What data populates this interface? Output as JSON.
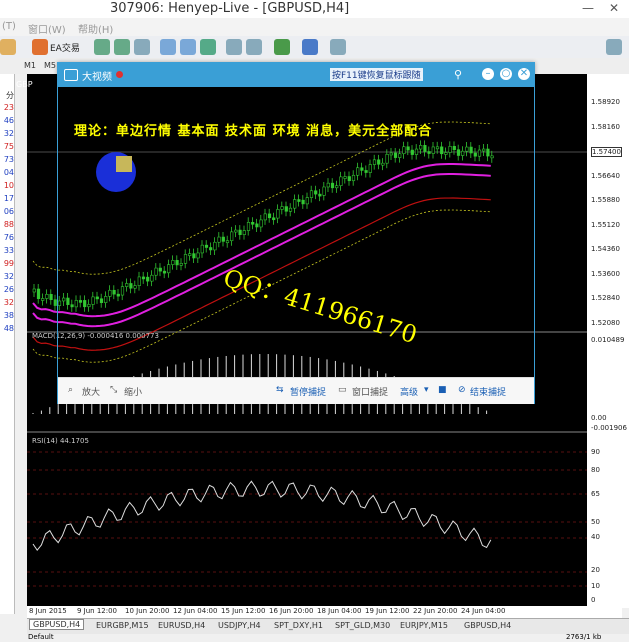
{
  "window": {
    "title": "307906: Henyep-Live - [GBPUSD,H4]",
    "min": "—",
    "close": "✕"
  },
  "menu": [
    "(T)",
    "窗口(W)",
    "帮助(H)"
  ],
  "toolbar": {
    "ea_label": "EA交易"
  },
  "timeframes": [
    "M1",
    "M5"
  ],
  "left_values": [
    "分",
    "23",
    "46",
    "32",
    "75",
    "73",
    "04",
    "10",
    "17",
    "06",
    "88",
    "76",
    "33",
    "99",
    "32",
    "26",
    "32",
    "38",
    "48"
  ],
  "left_label": "GBP",
  "macd_label": "MACD(12,26,9) -0.000416 0.000773",
  "rsi_label": "RSI(14) 44.1705",
  "price_axis": [
    "1.58920",
    "1.58160",
    "1.57400",
    "1.56640",
    "1.55880",
    "1.55120",
    "1.54360",
    "1.53600",
    "1.52840",
    "1.52080"
  ],
  "current_price": "1.57400",
  "macd_axis": [
    "0.010489",
    "0.00",
    "-0.001906"
  ],
  "rsi_axis": [
    "90",
    "80",
    "65",
    "50",
    "40",
    "20",
    "10",
    "0"
  ],
  "time_axis": [
    "8 Jun 2015",
    "9 Jun 12:00",
    "10 Jun 20:00",
    "12 Jun 04:00",
    "15 Jun 12:00",
    "16 Jun 20:00",
    "18 Jun 04:00",
    "19 Jun 12:00",
    "22 Jun 20:00",
    "24 Jun 04:00"
  ],
  "tabs": [
    "GBPUSD,H4",
    "EURGBP,M15",
    "EURUSD,H4",
    "USDJPY,H4",
    "SPT_DXY,H1",
    "SPT_GLD,M30",
    "EURJPY,M15",
    "GBPUSD,H4"
  ],
  "status": {
    "left": "Default",
    "right": "2763/1 kb"
  },
  "popup": {
    "title": "大视频",
    "hint": "按F11键恢复鼠标跟随",
    "footer": {
      "zoom_in": "放大",
      "zoom_out": "缩小",
      "pause": "暂停捕捉",
      "window_capture": "窗口捕捉",
      "advanced": "高级",
      "end": "结束捕捉"
    }
  },
  "overlay": {
    "theory": "理论：单边行情 基本面 技术面 环境 消息，美元全部配合",
    "qq": "QQ：411966170"
  },
  "colors": {
    "accent": "#3a9fd6",
    "chart_bg": "#000000",
    "bull": "#32c832",
    "ma_magenta": "#e020e0",
    "ma_red": "#c01010",
    "overlay_text": "#ffff00"
  }
}
